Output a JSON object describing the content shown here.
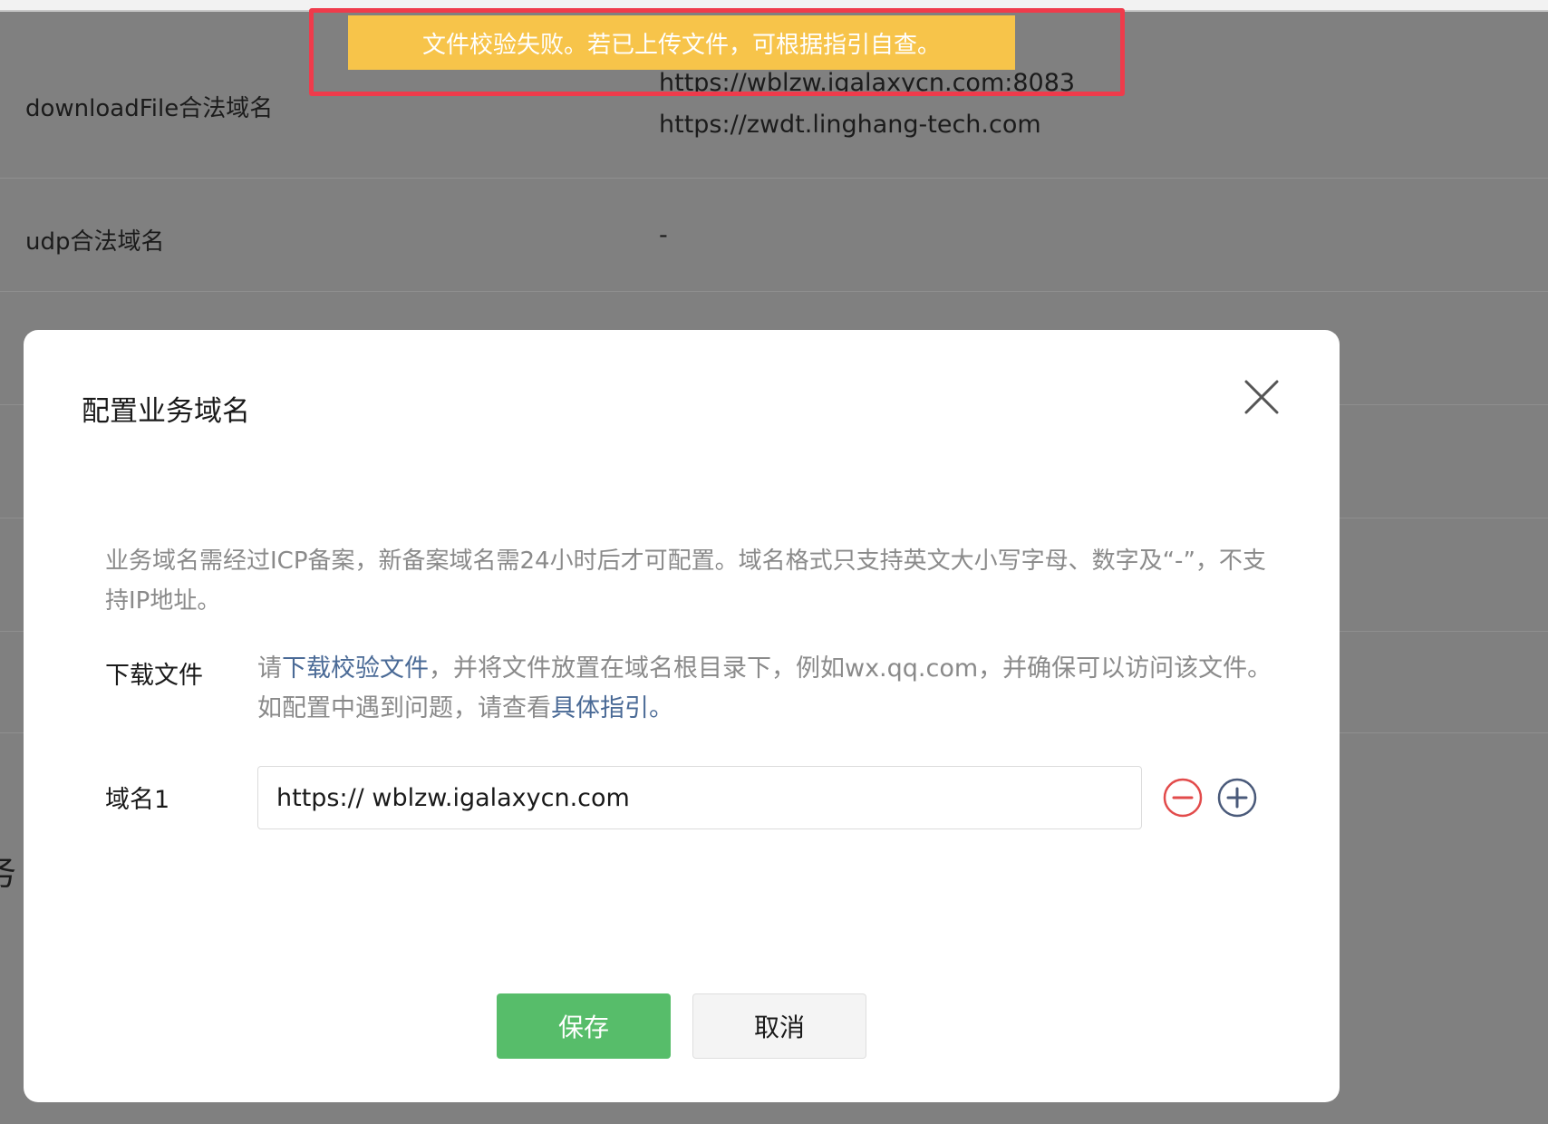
{
  "background": {
    "rows": [
      {
        "label": "downloadFile合法域名",
        "values": [
          "https://wblzw.igalaxycn.com:8083",
          "https://zwdt.linghang-tech.com"
        ]
      },
      {
        "label": "udp合法域名",
        "values": [
          "-"
        ]
      }
    ],
    "partial_char": "务"
  },
  "toast": {
    "message": "文件校验失败。若已上传文件，可根据指引自查。"
  },
  "modal": {
    "title": "配置业务域名",
    "description": "业务域名需经过ICP备案，新备案域名需24小时后才可配置。域名格式只支持英文大小写字母、数字及“-”，不支持IP地址。",
    "download": {
      "label": "下载文件",
      "text_prefix": "请",
      "link_download": "下载校验文件",
      "text_middle": "，并将文件放置在域名根目录下，例如wx.qq.com，并确保可以访问该文件。如配置中遇到问题，请查看",
      "link_guide": "具体指引",
      "text_suffix": "。"
    },
    "domain": {
      "label": "域名1",
      "value": "https:// wblzw.igalaxycn.com"
    },
    "buttons": {
      "save": "保存",
      "cancel": "取消"
    }
  },
  "colors": {
    "toast_bg": "#f7c44a",
    "highlight_border": "#ef3b4b",
    "primary_green": "#57bd6a",
    "link_blue": "#4a6a96",
    "remove_red": "#e24b4b",
    "add_blue": "#4a5a7a"
  },
  "icons": {
    "close": "close-icon",
    "remove": "minus-circle-icon",
    "add": "plus-circle-icon"
  }
}
